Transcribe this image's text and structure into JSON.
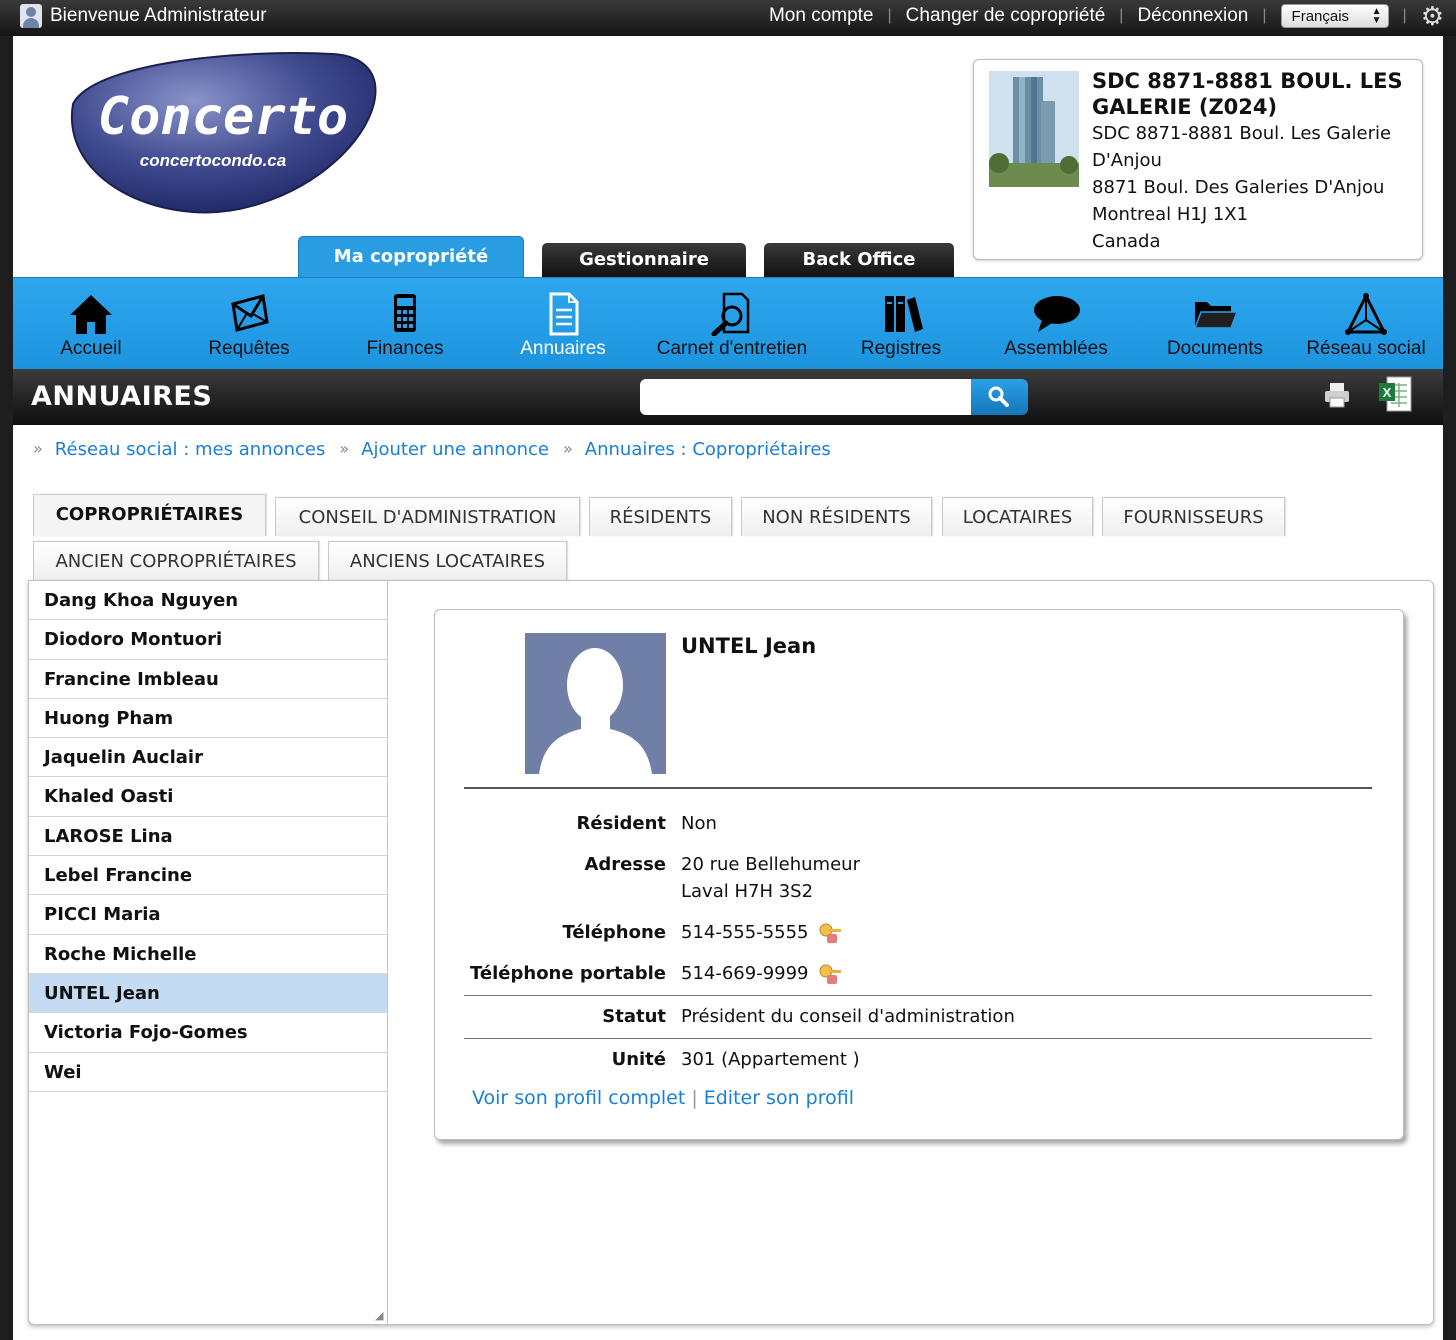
{
  "topbar": {
    "welcome": "Bienvenue Administrateur",
    "links": [
      "Mon compte",
      "Changer de copropriété",
      "Déconnexion"
    ],
    "language": "Français",
    "settings_icon": "gear-icon"
  },
  "logo": {
    "name": "Concerto",
    "site": "concertocondo.ca"
  },
  "building": {
    "title": "SDC 8871-8881 BOUL. LES GALERIE (Z024)",
    "lines": [
      "SDC 8871-8881 Boul. Les Galerie D'Anjou",
      "8871 Boul. Des Galeries D'Anjou",
      "Montreal H1J 1X1",
      "Canada"
    ]
  },
  "main_tabs": [
    "Ma copropriété",
    "Gestionnaire",
    "Back Office"
  ],
  "nav": [
    {
      "label": "Accueil",
      "icon": "home-icon"
    },
    {
      "label": "Requêtes",
      "icon": "envelope-icon"
    },
    {
      "label": "Finances",
      "icon": "calculator-icon"
    },
    {
      "label": "Annuaires",
      "icon": "document-icon"
    },
    {
      "label": "Carnet d'entretien",
      "icon": "magnifier-icon"
    },
    {
      "label": "Registres",
      "icon": "books-icon"
    },
    {
      "label": "Assemblées",
      "icon": "speech-bubble-icon"
    },
    {
      "label": "Documents",
      "icon": "folder-icon"
    },
    {
      "label": "Réseau social",
      "icon": "network-icon"
    }
  ],
  "section": {
    "title": "ANNUAIRES",
    "search_value": ""
  },
  "breadcrumb": [
    "Réseau social : mes annonces",
    "Ajouter une annonce",
    "Annuaires : Copropriétaires"
  ],
  "subtabs_row1": [
    "COPROPRIÉTAIRES",
    "CONSEIL D'ADMINISTRATION",
    "RÉSIDENTS",
    "NON RÉSIDENTS",
    "LOCATAIRES",
    "FOURNISSEURS"
  ],
  "subtabs_row2": [
    "ANCIEN COPROPRIÉTAIRES",
    "ANCIENS LOCATAIRES"
  ],
  "names": [
    "Dang Khoa Nguyen",
    "Diodoro Montuori",
    "Francine Imbleau",
    "Huong Pham",
    "Jaquelin Auclair",
    "Khaled Oasti",
    "LAROSE Lina",
    "Lebel Francine",
    "PICCI Maria",
    "Roche Michelle",
    "UNTEL Jean",
    "Victoria Fojo-Gomes",
    "Wei"
  ],
  "selected_name": "UNTEL Jean",
  "profile": {
    "name": "UNTEL Jean",
    "resident_label": "Résident",
    "resident": "Non",
    "address_label": "Adresse",
    "address_line1": "20 rue Bellehumeur",
    "address_line2": "Laval H7H 3S2",
    "phone_label": "Téléphone",
    "phone": "514-555-5555",
    "mobile_label": "Téléphone portable",
    "mobile": "514-669-9999",
    "status_label": "Statut",
    "status": "Président du conseil d'administration",
    "unit_label": "Unité",
    "unit": "301 (Appartement )",
    "link_full": "Voir son profil complet",
    "link_edit": "Editer son profil"
  }
}
